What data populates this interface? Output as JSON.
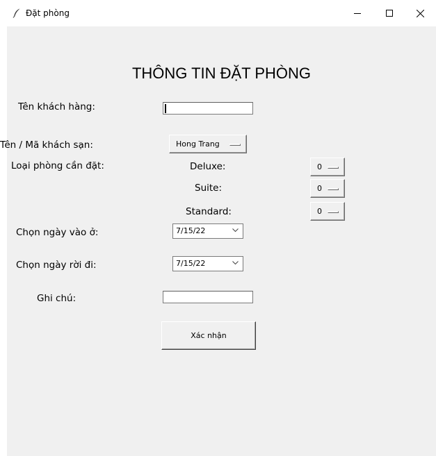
{
  "window": {
    "title": "Đặt phòng",
    "icon": "feather-icon"
  },
  "form": {
    "heading": "THÔNG TIN ĐẶT PHÒNG",
    "customer_name_label": "Tên khách hàng:",
    "customer_name_value": "",
    "hotel_label": "Tên / Mã khách sạn:",
    "hotel_value": "Hong Trang",
    "room_type_label": "Loại phòng cần đặt:",
    "rooms": [
      {
        "label": "Deluxe:",
        "value": "0"
      },
      {
        "label": "Suite:",
        "value": "0"
      },
      {
        "label": "Standard:",
        "value": "0"
      }
    ],
    "checkin_label": "Chọn ngày vào ở:",
    "checkin_value": "7/15/22",
    "checkout_label": "Chọn ngày rời đi:",
    "checkout_value": "7/15/22",
    "note_label": "Ghi chú:",
    "note_value": "",
    "confirm_label": "Xác nhận"
  }
}
